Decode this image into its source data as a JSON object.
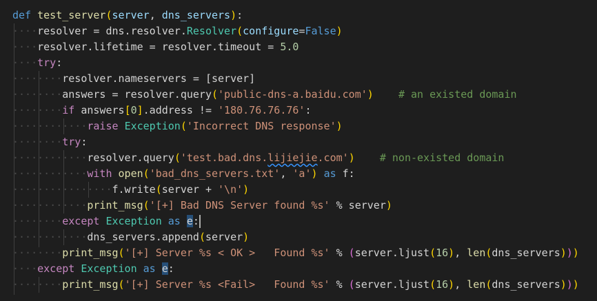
{
  "code": {
    "l1": {
      "def": "def",
      "name": "test_server",
      "open": "(",
      "p1": "server",
      "comma": ",",
      "p2": "dns_servers",
      "close": ")",
      "colon": ":"
    },
    "l2": {
      "lhs": "resolver = dns.resolver.",
      "cls": "Resolver",
      "open": "(",
      "kwarg": "configure",
      "eq": "=",
      "val": "False",
      "close": ")"
    },
    "l3": {
      "lhs": "resolver.lifetime = resolver.timeout = ",
      "num": "5.0"
    },
    "l4": {
      "kw": "try",
      "colon": ":"
    },
    "l5": {
      "text": "resolver.nameservers = [server]"
    },
    "l6": {
      "lhs": "answers = resolver.query",
      "open": "(",
      "str": "'public-dns-a.baidu.com'",
      "close": ")",
      "comment": "# an existed domain"
    },
    "l7": {
      "kw": "if",
      "mid1": " answers",
      "ob": "[",
      "idx": "0",
      "cb": "]",
      "mid2": ".address != ",
      "str": "'180.76.76.76'",
      "colon": ":"
    },
    "l8": {
      "kw": "raise",
      "cls": "Exception",
      "open": "(",
      "str": "'Incorrect DNS response'",
      "close": ")"
    },
    "l9": {
      "kw": "try",
      "colon": ":"
    },
    "l10": {
      "lhs": "resolver.query",
      "open": "(",
      "str_a": "'test.bad.dns.",
      "str_b": "lijiejie",
      "str_c": ".com'",
      "close": ")",
      "comment": "# non-existed domain"
    },
    "l11": {
      "kw": "with",
      "fn": "open",
      "open": "(",
      "s1": "'bad_dns_servers.txt'",
      "comma": ", ",
      "s2": "'a'",
      "close": ")",
      "as": "as",
      "var": "f:"
    },
    "l12": {
      "lhs": "f.write",
      "open": "(",
      "mid": "server + ",
      "str": "'\\n'",
      "close": ")"
    },
    "l13": {
      "fn": "print_msg",
      "open": "(",
      "str": "'[+] Bad DNS Server found %s'",
      "rest": " % server",
      "close": ")"
    },
    "l14": {
      "kw": "except",
      "cls": "Exception",
      "as": "as",
      "var": "e",
      "colon": ":"
    },
    "l15": {
      "lhs": "dns_servers.append",
      "open": "(",
      "arg": "server",
      "close": ")"
    },
    "l16": {
      "fn": "print_msg",
      "open": "(",
      "str": "'[+] Server %s < OK >   Found %s'",
      "mid": " % ",
      "open2": "(",
      "a1": "server.ljust",
      "open3": "(",
      "n1": "16",
      "close3": ")",
      "comma": ", ",
      "fn2": "len",
      "open4": "(",
      "a2": "dns_servers",
      "close4": ")",
      "close2": ")",
      "close": ")"
    },
    "l17": {
      "kw": "except",
      "cls": "Exception",
      "as": "as",
      "var": "e",
      "colon": ":"
    },
    "l18": {
      "fn": "print_msg",
      "open": "(",
      "str": "'[+] Server %s <Fail>   Found %s'",
      "mid": " % ",
      "open2": "(",
      "a1": "server.ljust",
      "open3": "(",
      "n1": "16",
      "close3": ")",
      "comma": ", ",
      "fn2": "len",
      "open4": "(",
      "a2": "dns_servers",
      "close4": ")",
      "close2": ")",
      "close": ")"
    }
  },
  "whitespace": {
    "d1": "····",
    "d2": "········",
    "d3": "············",
    "d4": "················"
  },
  "colors": {
    "background": "#1e1e1e",
    "keyword": "#569cd6",
    "control": "#c586c0",
    "function": "#dcdcaa",
    "string": "#ce9178",
    "number": "#b5cea8",
    "class": "#4ec9b0",
    "comment": "#6a9955"
  }
}
